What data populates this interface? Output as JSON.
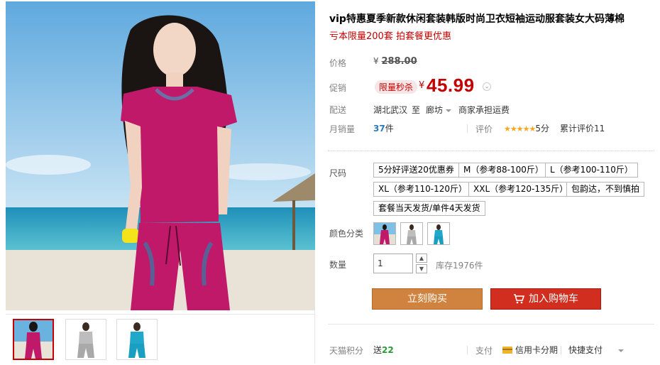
{
  "product": {
    "title": "vip特惠夏季新款休闲套装韩版时尚卫衣短袖运动服套装女大码薄棉",
    "subtitle": "亏本限量200套 拍套餐更优惠"
  },
  "price": {
    "label": "价格",
    "currency": "¥",
    "original": "288.00",
    "promo_label": "促销",
    "promo_badge": "限量秒杀",
    "promo_currency": "¥",
    "promo_price": "45.99"
  },
  "shipping": {
    "label": "配送",
    "from": "湖北武汉",
    "to_word": "至",
    "dest": "廊坊",
    "fee": "商家承担运费"
  },
  "sales": {
    "label": "月销量",
    "count": "37",
    "unit": "件",
    "rating_label": "评价",
    "stars": "★★★★★",
    "score": "5分",
    "total_reviews": "累计评价11"
  },
  "sku": {
    "size_label": "尺码",
    "sizes": [
      "5分好评送20优惠券",
      "M（参考88-100斤）",
      "L（参考100-110斤）",
      "XL（参考110-120斤）",
      "XXL（参考120-135斤）",
      "包韵达，不到慎拍",
      "套餐当天发货/单件4天发货"
    ],
    "color_label": "颜色分类"
  },
  "quantity": {
    "label": "数量",
    "value": "1",
    "up": "▲",
    "down": "▼",
    "stock": "库存1976件"
  },
  "actions": {
    "buy_now": "立刻购买",
    "add_to_cart": "加入购物车"
  },
  "footer": {
    "points_label": "天猫积分",
    "points_prefix": "送",
    "points_value": "22",
    "pay_label": "支付",
    "credit_installment": "信用卡分期",
    "quick_pay": "快捷支付"
  },
  "colors": {
    "accent": "#c40000",
    "buy": "#d0833e",
    "cart": "#d22e1f",
    "sales": "#2e7abb",
    "points": "#2b9b38",
    "garment": "#c0196a"
  }
}
